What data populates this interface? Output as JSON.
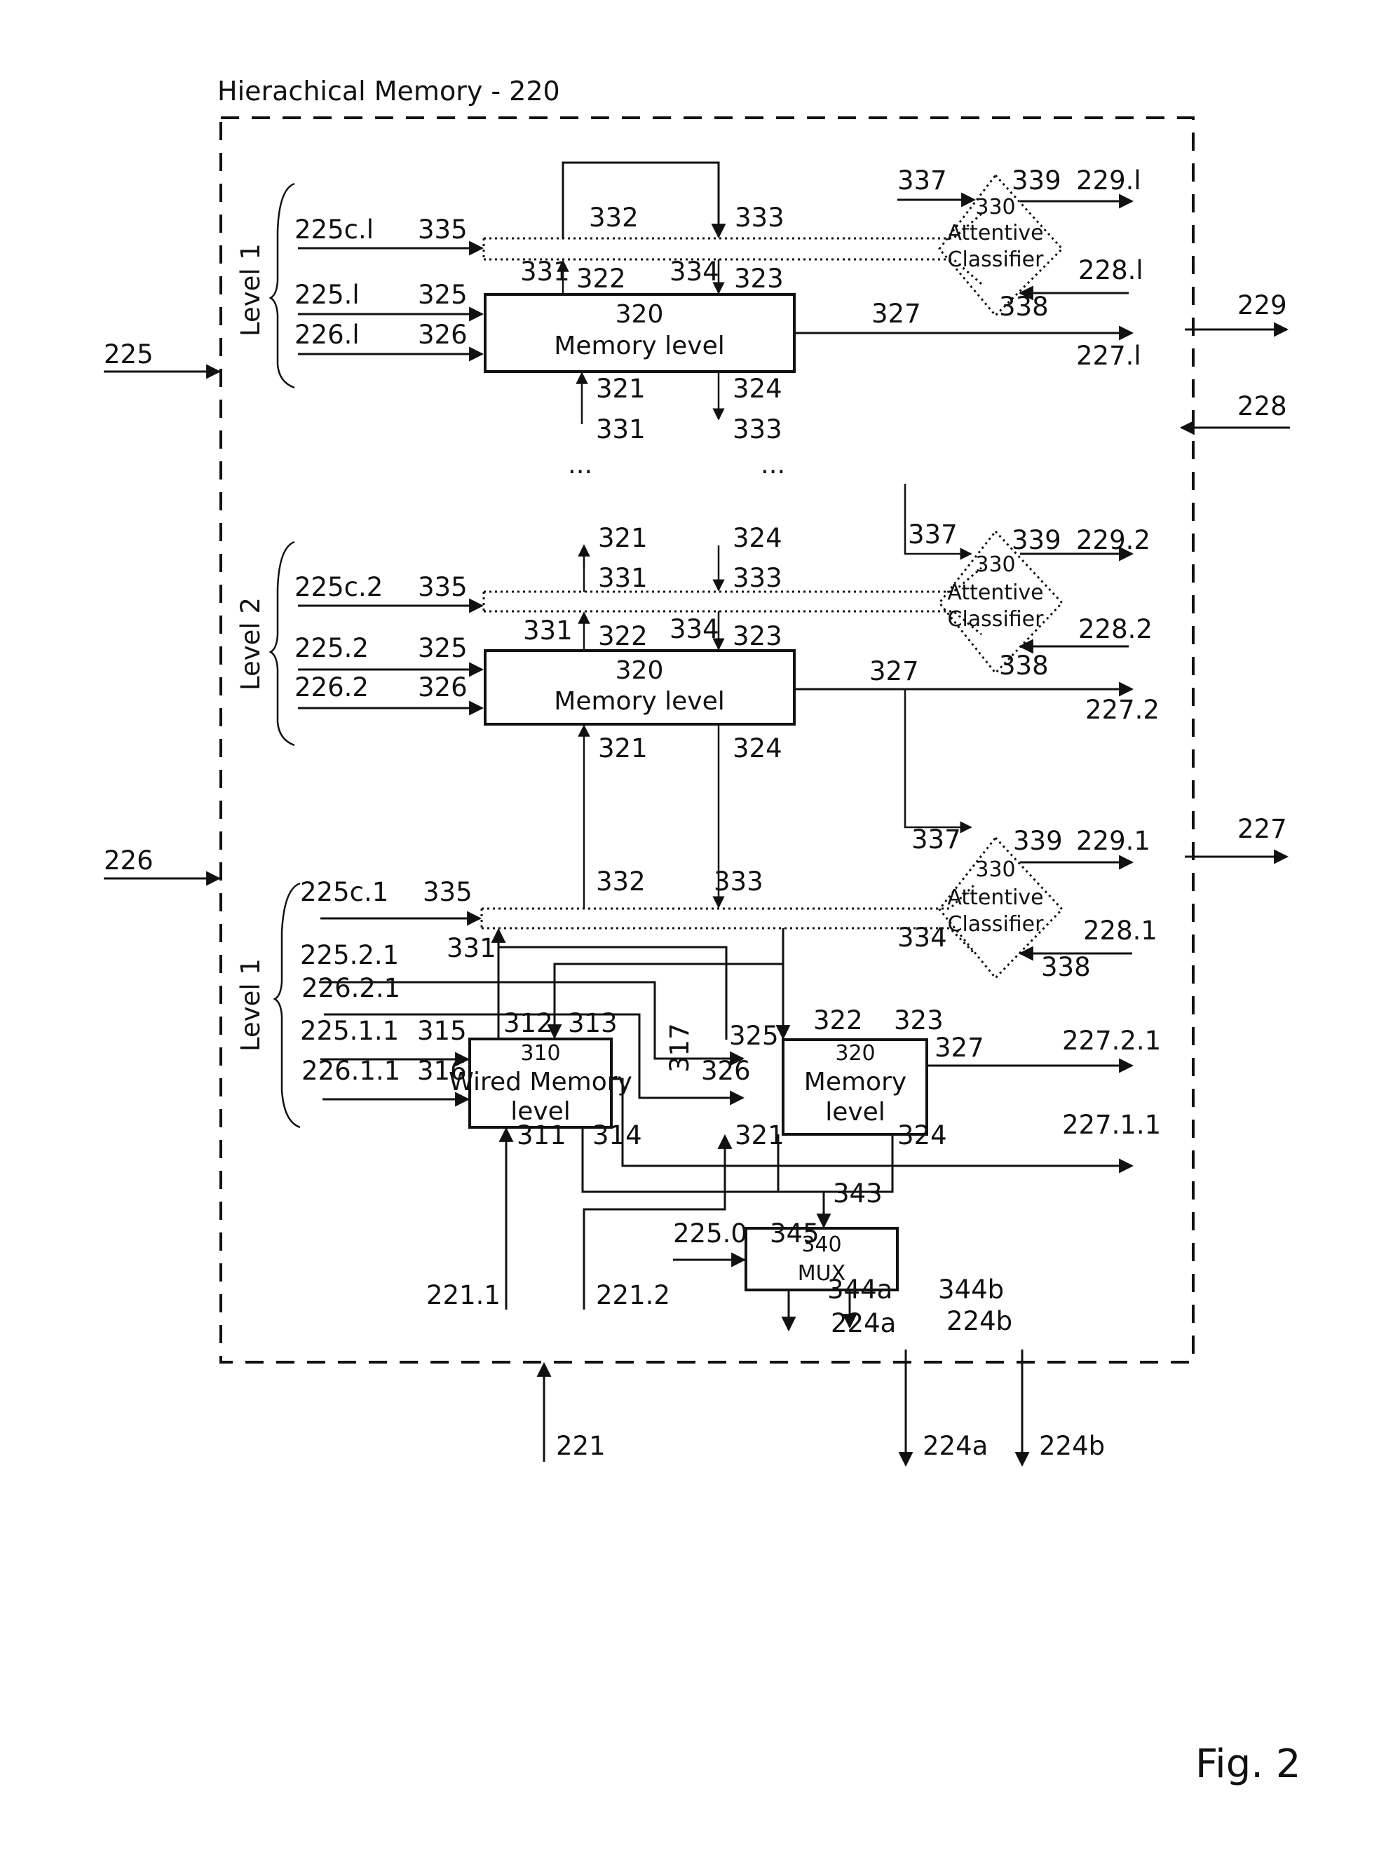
{
  "figure": {
    "title": "Hierachical Memory - 220",
    "caption": "Fig. 2",
    "ellipsis": "..."
  },
  "external": {
    "in_225": "225",
    "in_226": "226",
    "out_229": "229",
    "in_228": "228",
    "out_227": "227",
    "in_221": "221",
    "out_224a": "224a",
    "out_224b": "224b"
  },
  "levels": [
    {
      "id": "top",
      "brace_label": "Level 1",
      "inputs": [
        "225c.l",
        "225.l",
        "226.l"
      ],
      "ports": {
        "p335": "335",
        "p325": "325",
        "p326": "326",
        "p332": "332",
        "p333": "333",
        "p331": "331",
        "p322": "322",
        "p334": "334",
        "p323": "323",
        "p327": "327",
        "p321": "321",
        "p324": "324",
        "below_331": "331",
        "below_333": "333"
      },
      "memory_box": {
        "number": "320",
        "name": "Memory level"
      },
      "classifier": {
        "number": "330",
        "line1": "Attentive",
        "line2": "Classifier",
        "in_337": "337",
        "out_339": "339",
        "in_338": "338"
      },
      "out_229": "229.l",
      "in_228": "228.l",
      "out_227": "227.l"
    },
    {
      "id": "middle",
      "brace_label": "Level 2",
      "inputs": [
        "225c.2",
        "225.2",
        "226.2"
      ],
      "ports": {
        "p335": "335",
        "p325": "325",
        "p326": "326",
        "above_321": "321",
        "above_331": "331",
        "above_324": "324",
        "above_333": "333",
        "p331": "331",
        "p322": "322",
        "p334": "334",
        "p323": "323",
        "p327": "327",
        "p321": "321",
        "p324": "324"
      },
      "memory_box": {
        "number": "320",
        "name": "Memory level"
      },
      "classifier": {
        "number": "330",
        "line1": "Attentive",
        "line2": "Classifier",
        "in_337": "337",
        "out_339": "339",
        "in_338": "338"
      },
      "out_229": "229.2",
      "in_228": "228.2",
      "out_227": "227.2"
    },
    {
      "id": "bottom",
      "brace_label": "Level 1",
      "inputs": [
        "225c.1",
        "225.2.1",
        "226.2.1",
        "225.1.1",
        "226.1.1"
      ],
      "ports": {
        "p335": "335",
        "p332": "332",
        "p333": "333",
        "p331": "331",
        "p334": "334",
        "p312": "312",
        "p313": "313",
        "p315": "315",
        "p316": "316",
        "p317": "317",
        "p311": "311",
        "p314": "314",
        "p325": "325",
        "p326": "326",
        "p322": "322",
        "p323": "323",
        "p327": "327",
        "p321": "321",
        "p324": "324"
      },
      "wired_box": {
        "number": "310",
        "line1": "Wired Memory",
        "line2": "level"
      },
      "memory_box": {
        "number": "320",
        "line1": "Memory",
        "line2": "level"
      },
      "classifier": {
        "number": "330",
        "line1": "Attentive",
        "line2": "Classifier",
        "in_337": "337",
        "out_339": "339",
        "in_338": "338"
      },
      "out_229": "229.1",
      "in_228": "228.1",
      "out_227_2": "227.2.1",
      "out_227_1": "227.1.1",
      "in_221_1": "221.1",
      "in_221_2": "221.2"
    }
  ],
  "mux": {
    "number": "340",
    "name": "MUX",
    "in_343": "343",
    "in_345": "345",
    "in_225_0": "225.0",
    "out_344a": "344a",
    "out_344b": "344b",
    "out_224a": "224a",
    "out_224b": "224b"
  }
}
